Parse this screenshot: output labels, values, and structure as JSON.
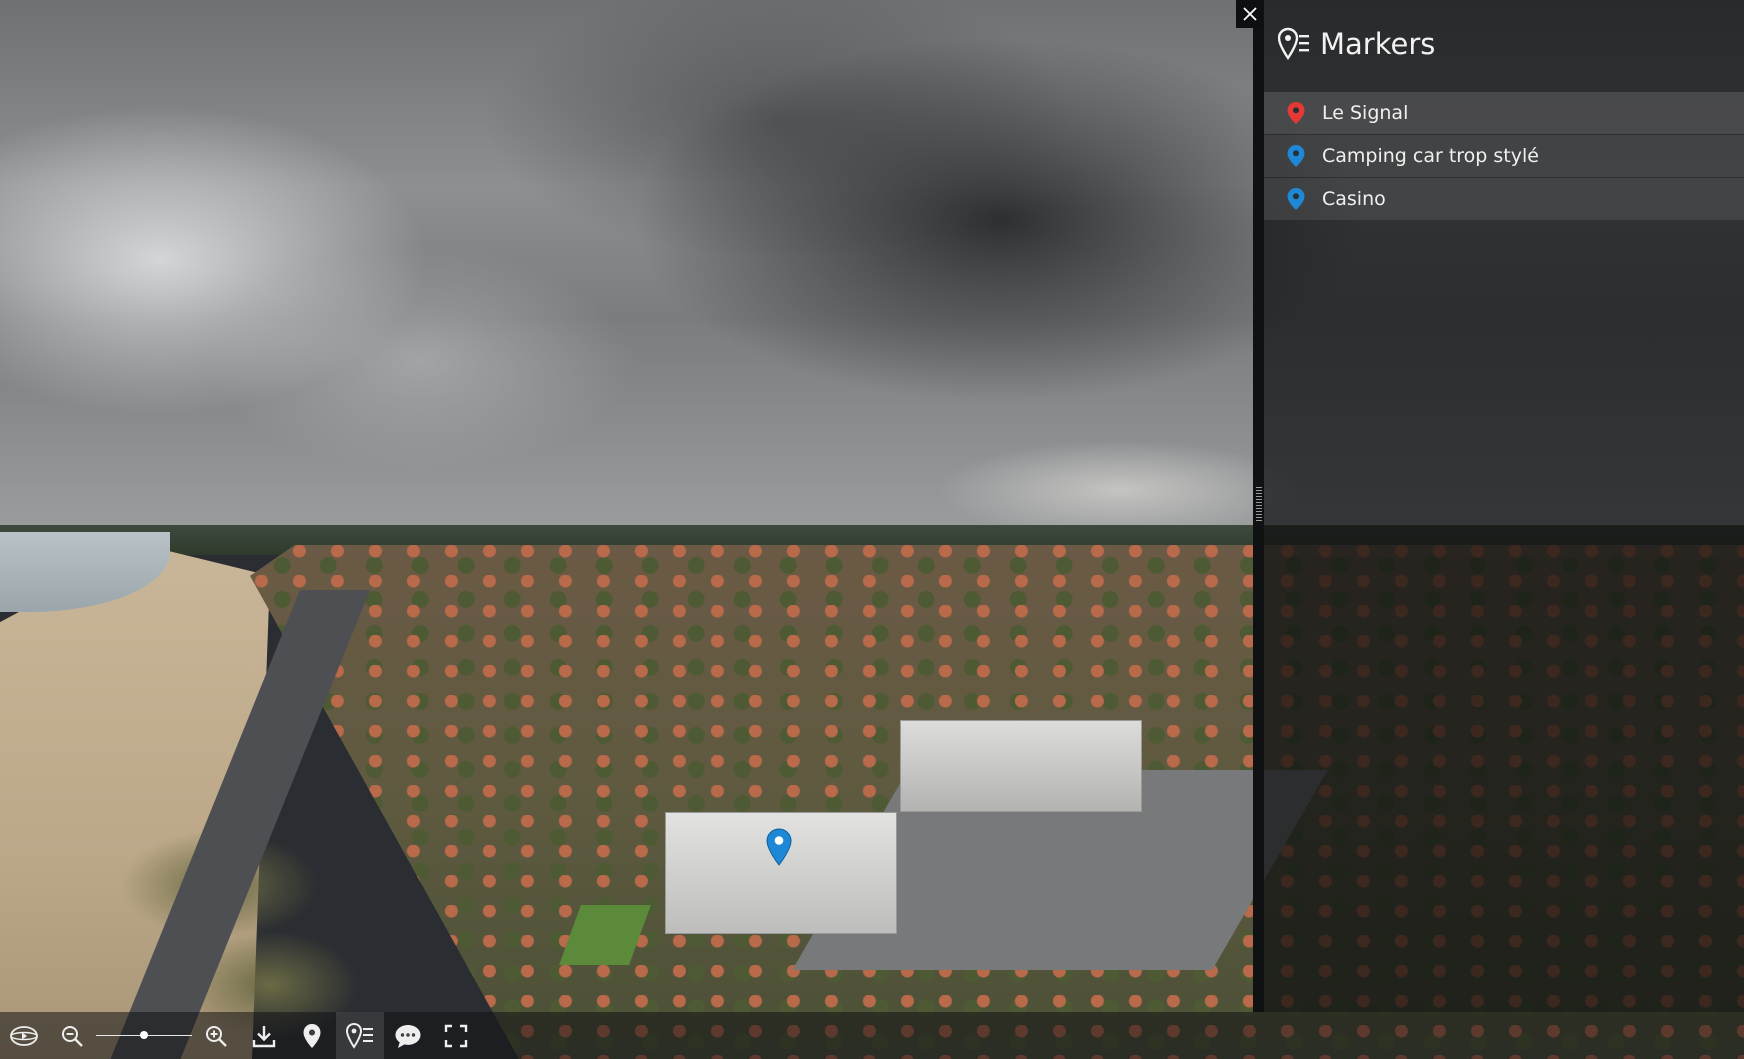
{
  "viewer": {
    "panorama_description_icon": "pin-marker-icon",
    "pano_marker_color": "#1e88d6"
  },
  "side_panel": {
    "close_icon": "close-icon",
    "header_icon": "markers-list-icon",
    "title": "Markers",
    "items": [
      {
        "label": "Le Signal",
        "pin_color": "#e53935",
        "icon": "map-pin-icon"
      },
      {
        "label": "Camping car trop stylé",
        "pin_color": "#1e88d6",
        "icon": "map-pin-icon"
      },
      {
        "label": "Casino",
        "pin_color": "#1e88d6",
        "icon": "map-pin-icon"
      }
    ]
  },
  "navbar": {
    "buttons": [
      "autorotate-icon",
      "zoom-out-icon",
      "zoom-range",
      "zoom-in-icon",
      "download-icon",
      "markers-icon",
      "markers-list-icon",
      "caption-icon",
      "fullscreen-icon"
    ],
    "zoom_level": 0.5,
    "active_button": "markers-list-icon"
  }
}
